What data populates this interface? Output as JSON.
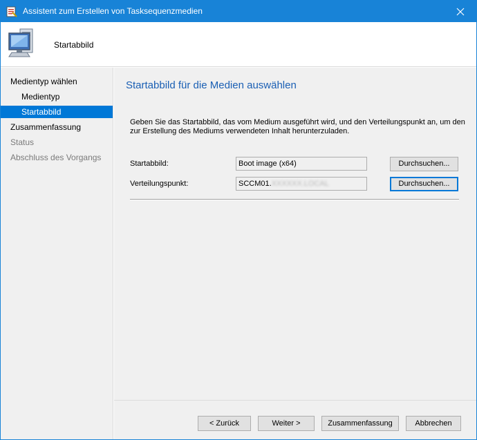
{
  "window": {
    "title": "Assistent zum Erstellen von Tasksequenzmedien"
  },
  "header": {
    "title": "Startabbild"
  },
  "sidebar": {
    "items": [
      {
        "label": "Medientyp wählen",
        "level": "top",
        "state": "normal"
      },
      {
        "label": "Medientyp",
        "level": "sub",
        "state": "normal"
      },
      {
        "label": "Startabbild",
        "level": "sub",
        "state": "selected"
      },
      {
        "label": "Zusammenfassung",
        "level": "top",
        "state": "normal"
      },
      {
        "label": "Status",
        "level": "top",
        "state": "disabled"
      },
      {
        "label": "Abschluss des Vorgangs",
        "level": "top",
        "state": "disabled"
      }
    ]
  },
  "main": {
    "heading": "Startabbild für die Medien auswählen",
    "description": "Geben Sie das Startabbild, das vom Medium ausgeführt wird, und den Verteilungspunkt an, um den zur Erstellung des Mediums verwendeten Inhalt herunterzuladen.",
    "boot_image": {
      "label": "Startabbild:",
      "value": "Boot image (x64)",
      "browse_label": "Durchsuchen..."
    },
    "distribution_point": {
      "label": "Verteilungspunkt:",
      "value": "SCCM01.",
      "value_redacted": "XXXXXX.LOCAL",
      "browse_label": "Durchsuchen..."
    }
  },
  "footer": {
    "back_label": "< Zurück",
    "next_label": "Weiter >",
    "summary_label": "Zusammenfassung",
    "cancel_label": "Abbrechen"
  },
  "colors": {
    "title_bar": "#1883d7",
    "selection": "#0078d7",
    "heading": "#1a5fb4",
    "panel": "#f0f0f0"
  }
}
